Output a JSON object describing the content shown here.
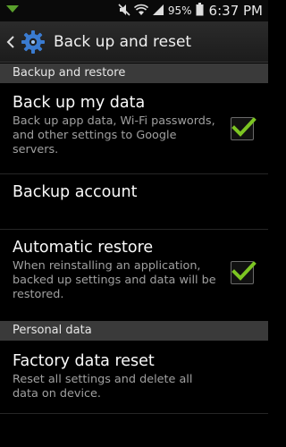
{
  "status_bar": {
    "battery_text": "95%",
    "time": "6:37 PM",
    "icons": [
      "download-notification-icon",
      "mute-icon",
      "wifi-icon",
      "signal-icon",
      "battery-icon"
    ]
  },
  "action_bar": {
    "title": "Back up and reset",
    "icon": "gear-icon"
  },
  "sections": [
    {
      "header": "Backup and restore",
      "items": [
        {
          "title": "Back up my data",
          "summary": "Back up app data, Wi-Fi passwords, and other settings to Google servers.",
          "checked": true
        },
        {
          "title": "Backup account",
          "summary": ""
        },
        {
          "title": "Automatic restore",
          "summary": "When reinstalling an application, backed up settings and data will be restored.",
          "checked": true
        }
      ]
    },
    {
      "header": "Personal data",
      "items": [
        {
          "title": "Factory data reset",
          "summary": "Reset all settings and delete all data on device."
        }
      ]
    }
  ],
  "colors": {
    "accent_green": "#7cc522",
    "section_header_bg": "#3a3a3a"
  }
}
